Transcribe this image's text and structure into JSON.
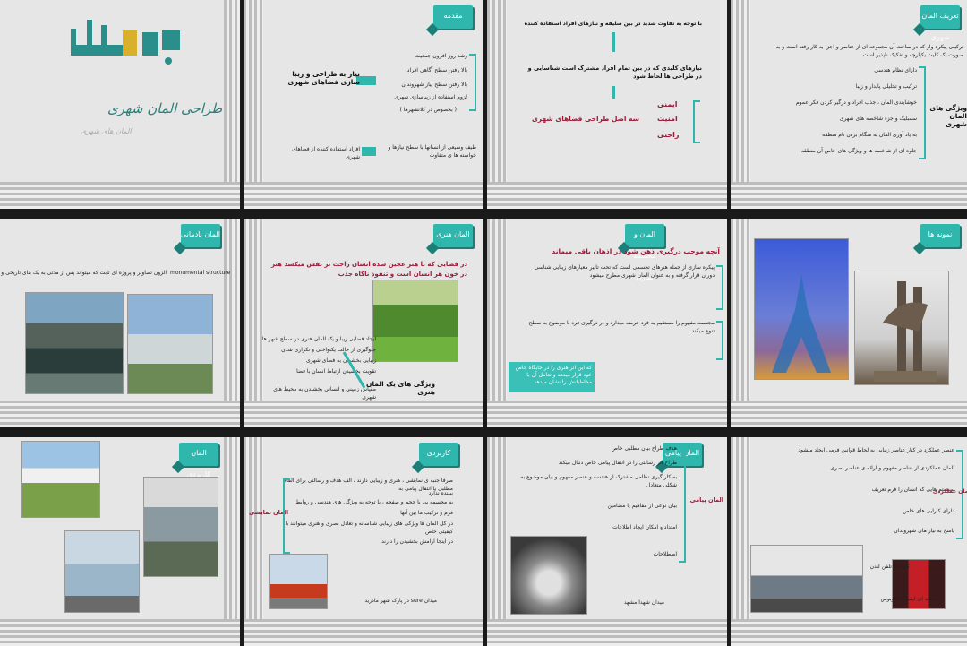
{
  "slides": [
    {
      "id": 1,
      "logo_text": "بسم الله",
      "title": "طراحی المان شهری",
      "subtitle": "المان های شهری"
    },
    {
      "id": 2,
      "tag": "مقدمه",
      "lines": [
        "رشد روز افزون جمعیت",
        "بالا رفتن سطح آگاهی افراد",
        "بالا رفتن سطح نیاز شهروندان",
        "لزوم استفاده از زیباسازی شهری",
        "( بخصوص در کلانشهرها )"
      ],
      "need": "نیاز به طراحی و زیبا سازی فضاهای شهری",
      "bottom": "افراد استفاده کننده از فضاهای شهری",
      "spectrum": "طیف وسیعی از انسانها با سطح نیازها و خواسته ها ی متفاوت"
    },
    {
      "id": 3,
      "top": "با توجه به تفاوت شدید در بین سلیقه و نیازهای افراد استفاده کننده",
      "mid": "نیازهای کلیدی که در بین تمام افراد مشترک است شناسایی و در طراحی ها لحاظ شود",
      "principles": [
        "ایمنی",
        "امنیت",
        "راحتی"
      ],
      "three": "سه اصل طراحی فضاهای شهری"
    },
    {
      "id": 4,
      "tag": "تعریف المان شهری",
      "intro": "ترکیبی پیکره وار که در ساخت آن مجموعه ای از عناصر و اجزا به کار رفته است و به صورت یک کلیت یکپارچه و تفکیک ناپذیر است.",
      "features": [
        "دارای نظام هندسی",
        "ترکیب و تحلیلی پایدار و زیبا",
        "خوشایندی المان ، جذب افراد و درگیر کردن فکر عموم",
        "سمبلیک و جزء شاخصه های شهری",
        "به یاد آوری المان به هنگام بردن نام منطقه",
        "جلوه ای از شاخصه ها و ویژگی های خاص آن منطقه"
      ],
      "side": "ویژگی های المان شهری"
    },
    {
      "id": 5,
      "tag": "المان یادمانی",
      "text": "الزون تصاویر و پروژه ای ثابت که میتواند پس از مدتی به یک بنای تاریخی و ماندگار تبدیل شود و منطقه را به نام خود ثبت کند",
      "en": "monumental structure"
    },
    {
      "id": 6,
      "tag": "المان هنری",
      "head": "در فضایی که با هنر عجین شده انسان راحت تر نفس میکشد هنر در خون هر انسان است و تنفوذ ناگاه جذب",
      "lines": [
        "ایجاد فضایی زیبا و یک المان هنری در سطح شهر ها",
        "جلوگیری از حالت یکنواختی و تکراری شدن",
        "زیبایی بخشیدن به فضای شهری",
        "تقویت بخشیدن ارتباط انسان با فضا",
        "مقیاس زمینی و انسانی بخشیدن به محیط های شهری"
      ],
      "side": "ویژگی های یک المان هنری"
    },
    {
      "id": 7,
      "tag": "المان و مجسمه سازی",
      "head": "آنچه موجب درگیری ذهن شود در اذهان باقی میماند",
      "p1": "پیکره سازی از جمله هنرهای تجسمی است که تحت تاثیر معیارهای زیبایی شناسی دوران قرار گرفته و به عنوان المان شهری مطرح میشود",
      "p2": "مجسمه مفهوم را مستقیم به فرد عرضه میدارد و در درگیری فرد با موضوع به سطح تنوع میکند",
      "box": "که این اثر هنری را در جایگاه خاص خود قرار میدهد و تعامل آن با مخاطبانش را نشان میدهد"
    },
    {
      "id": 8,
      "tag": "نمونه ها"
    },
    {
      "id": 9,
      "tag": "المان کاربردی"
    },
    {
      "id": 10,
      "tag": "کاربردی",
      "side1": "المان نمایشی",
      "lines": [
        "صرفا جنبه ی نمایشی ، هنری و زیبایی دارند ، الف هدف و رسالتی برای القاء مطلبی یا انتقال پیامی به",
        "بیننده ندارد",
        "یه مجسمه بی یا حجم و صفحه ، با توجه به ویژگی های هندسی و روابط",
        "فرم و ترکیب ما بین آنها",
        "در کل المان ها ویژگی های زیبایی شناسانه و تعادل بصری و هنری میتوانند با کیفیتی خاص",
        "در اینجا آرامش بخشیدن را دارند"
      ],
      "caption": "میدان sure در پارک شهر مادرید"
    },
    {
      "id": 11,
      "tag": "المان پیامی",
      "lines": [
        "هدف طراح بیان مطلبی خاص",
        "طراح اثر رسالتی را در انتقال پیامی خاص دنبال میکند",
        "به کار گیری نظامی مشترک از هندسه و عنصر مفهوم و بیان موضوع به شکلی متعادل",
        "بیان نوعی از مفاهیم یا مضامین",
        "امتداد و امکان ایجاد اطلاعات",
        "اصطلاحات"
      ],
      "side": "المان پیامی",
      "caption": "میدان شهدا مشهد"
    },
    {
      "id": 12,
      "lines": [
        "عنصر عملکرد در کنار عناصر زیبایی به لحاظ قوانین فرمی ایجاد میشود",
        "المان عملکردی از عناصر مفهوم و ارائه ی عناصر بصری",
        "سیستم هایی که انسان را فرم تعریف",
        "دارای کارایی های خاص",
        "پاسخ به نیاز های شهروندان"
      ],
      "side": "المان عملکردی",
      "cap1": "کیوسک تلفن لندن",
      "cap2": "نمونه ای ایستگاه اتوبوس"
    }
  ]
}
